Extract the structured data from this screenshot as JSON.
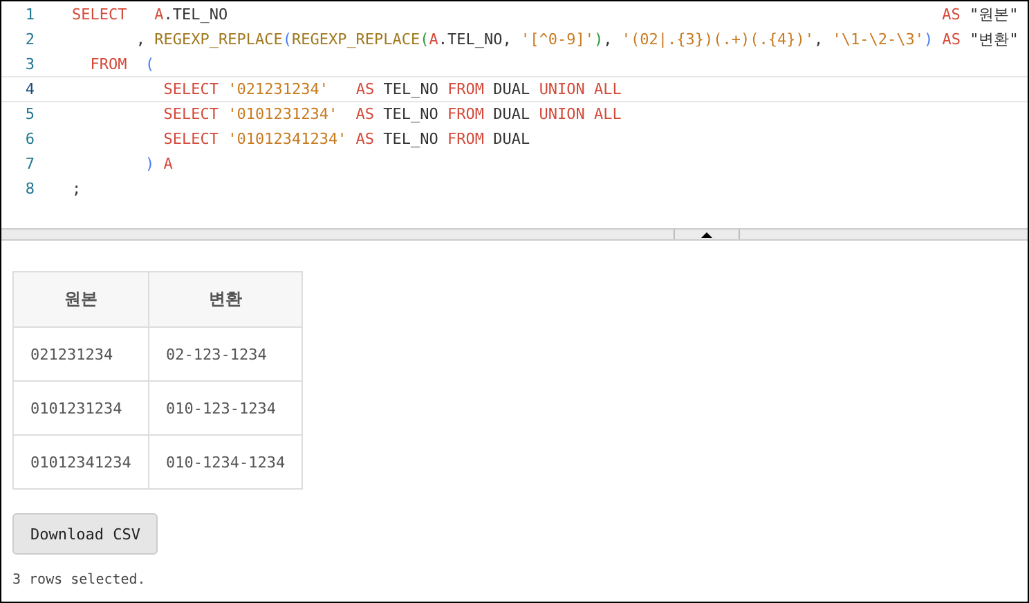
{
  "editor": {
    "lines": [
      {
        "number": "1",
        "current": false,
        "tokens": [
          {
            "kind": "keyword",
            "text": "SELECT"
          },
          {
            "kind": "alias",
            "text": "   A"
          },
          {
            "kind": "plain",
            "text": ".TEL_NO"
          },
          {
            "kind": "keyword",
            "text": "                                                                              AS"
          },
          {
            "kind": "plain",
            "text": " \"원본\""
          }
        ]
      },
      {
        "number": "2",
        "current": false,
        "tokens": [
          {
            "kind": "plain",
            "text": "       , "
          },
          {
            "kind": "function",
            "text": "REGEXP_REPLACE"
          },
          {
            "kind": "bracket1",
            "text": "("
          },
          {
            "kind": "function",
            "text": "REGEXP_REPLACE"
          },
          {
            "kind": "bracket2",
            "text": "("
          },
          {
            "kind": "alias",
            "text": "A"
          },
          {
            "kind": "plain",
            "text": ".TEL_NO, "
          },
          {
            "kind": "string",
            "text": "'[^0-9]'"
          },
          {
            "kind": "bracket2",
            "text": ")"
          },
          {
            "kind": "plain",
            "text": ", "
          },
          {
            "kind": "string",
            "text": "'(02|.{3})(.+)(.{4})'"
          },
          {
            "kind": "plain",
            "text": ", "
          },
          {
            "kind": "string",
            "text": "'\\1-\\2-\\3'"
          },
          {
            "kind": "bracket1",
            "text": ")"
          },
          {
            "kind": "keyword",
            "text": " AS"
          },
          {
            "kind": "plain",
            "text": " \"변환\""
          }
        ]
      },
      {
        "number": "3",
        "current": false,
        "tokens": [
          {
            "kind": "keyword",
            "text": "  FROM"
          },
          {
            "kind": "bracket1",
            "text": "  ("
          }
        ]
      },
      {
        "number": "4",
        "current": true,
        "tokens": [
          {
            "kind": "keyword",
            "text": "          SELECT"
          },
          {
            "kind": "string",
            "text": " '021231234'"
          },
          {
            "kind": "keyword",
            "text": "   AS"
          },
          {
            "kind": "plain",
            "text": " TEL_NO "
          },
          {
            "kind": "keyword",
            "text": "FROM"
          },
          {
            "kind": "plain",
            "text": " DUAL "
          },
          {
            "kind": "keyword",
            "text": "UNION ALL"
          }
        ]
      },
      {
        "number": "5",
        "current": false,
        "tokens": [
          {
            "kind": "keyword",
            "text": "          SELECT"
          },
          {
            "kind": "string",
            "text": " '0101231234'"
          },
          {
            "kind": "keyword",
            "text": "  AS"
          },
          {
            "kind": "plain",
            "text": " TEL_NO "
          },
          {
            "kind": "keyword",
            "text": "FROM"
          },
          {
            "kind": "plain",
            "text": " DUAL "
          },
          {
            "kind": "keyword",
            "text": "UNION ALL"
          }
        ]
      },
      {
        "number": "6",
        "current": false,
        "tokens": [
          {
            "kind": "keyword",
            "text": "          SELECT"
          },
          {
            "kind": "string",
            "text": " '01012341234'"
          },
          {
            "kind": "keyword",
            "text": " AS"
          },
          {
            "kind": "plain",
            "text": " TEL_NO "
          },
          {
            "kind": "keyword",
            "text": "FROM"
          },
          {
            "kind": "plain",
            "text": " DUAL"
          }
        ]
      },
      {
        "number": "7",
        "current": false,
        "tokens": [
          {
            "kind": "bracket1",
            "text": "        )"
          },
          {
            "kind": "alias",
            "text": " A"
          }
        ]
      },
      {
        "number": "8",
        "current": false,
        "tokens": [
          {
            "kind": "plain",
            "text": ";"
          }
        ]
      }
    ]
  },
  "results": {
    "columns": [
      "원본",
      "변환"
    ],
    "rows": [
      [
        "021231234",
        "02-123-1234"
      ],
      [
        "0101231234",
        "010-123-1234"
      ],
      [
        "01012341234",
        "010-1234-1234"
      ]
    ],
    "download_button": "Download CSV",
    "status": "3 rows selected."
  }
}
